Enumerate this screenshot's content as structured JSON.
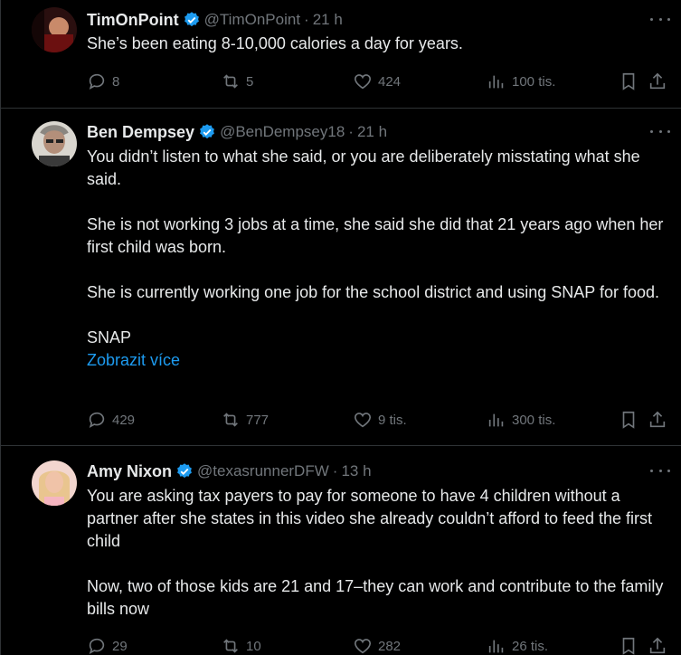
{
  "colors": {
    "background": "#000000",
    "text": "#e7e9ea",
    "muted": "#71767b",
    "accent": "#1d9bf0",
    "divider": "#2f3336"
  },
  "tweets": [
    {
      "name": "TimOnPoint",
      "handle": "@TimOnPoint",
      "time": "21 h",
      "paragraphs": [
        "She’s been eating 8-10,000 calories a day for years."
      ],
      "show_more": "",
      "replies": "8",
      "reposts": "5",
      "likes": "424",
      "views": "100 tis."
    },
    {
      "name": "Ben Dempsey",
      "handle": "@BenDempsey18",
      "time": "21 h",
      "paragraphs": [
        "You didn’t listen to what she said, or you are deliberately misstating what she said.",
        "She is not working 3 jobs at a time, she said she did that 21 years ago when her first child was born.",
        "She is currently working one job for the school district and using SNAP for food.",
        "SNAP"
      ],
      "show_more": "Zobrazit více",
      "replies": "429",
      "reposts": "777",
      "likes": "9 tis.",
      "views": "300 tis."
    },
    {
      "name": "Amy Nixon",
      "handle": "@texasrunnerDFW",
      "time": "13 h",
      "paragraphs": [
        "You are asking tax payers to pay for someone to have 4 children without a partner after she states in this video she already couldn’t afford to feed the first child",
        "Now, two of those kids are 21 and 17–they can work and contribute to the family bills now"
      ],
      "show_more": "",
      "replies": "29",
      "reposts": "10",
      "likes": "282",
      "views": "26 tis."
    }
  ],
  "icons": [
    "reply-icon",
    "repost-icon",
    "like-icon",
    "views-icon",
    "bookmark-icon",
    "share-icon",
    "more-icon",
    "verified-badge-icon"
  ]
}
